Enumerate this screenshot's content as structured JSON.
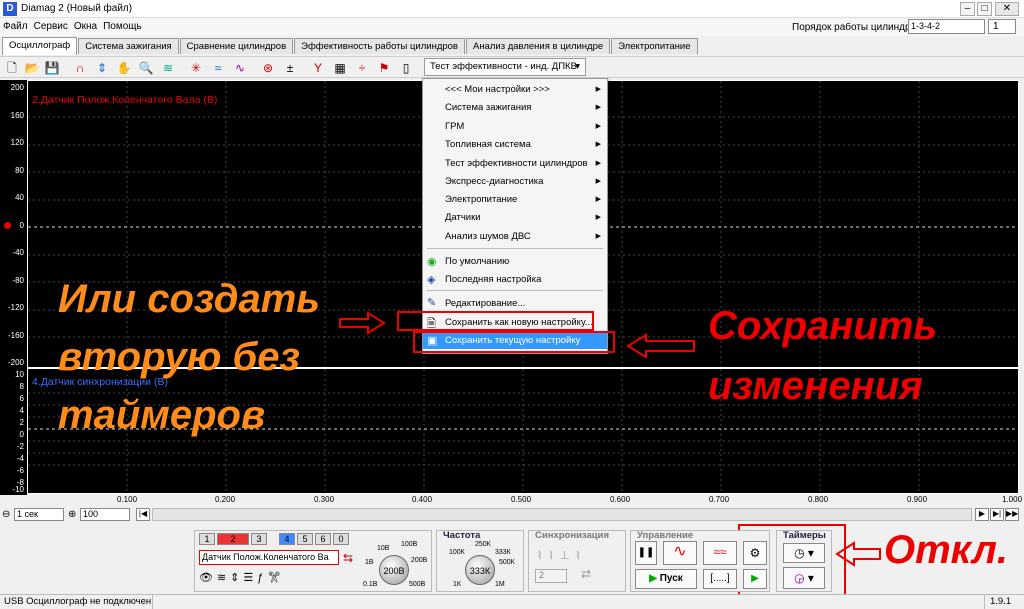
{
  "window": {
    "app_icon": "D",
    "title": "Diamag 2 (Новый файл)"
  },
  "menubar": {
    "items": [
      "Файл",
      "Сервис",
      "Окна",
      "Помощь"
    ]
  },
  "cyl_order": {
    "label": "Порядок работы цилиндров",
    "value": "1-3-4-2",
    "spin_value": "1"
  },
  "tabs": [
    "Осциллограф",
    "Система зажигания",
    "Сравнение цилиндров",
    "Эффективность работы цилиндров",
    "Анализ давления в цилиндре",
    "Электропитание"
  ],
  "toolbar": {
    "preset_button": "Тест эффективности - инд. ДПКВ"
  },
  "scope": {
    "ch1_label": "2.Датчик Полож.Коленчатого Вала (В)",
    "ch2_label": "4.Датчик синхронизации (В)",
    "y1": [
      "200",
      "160",
      "120",
      "80",
      "40",
      "0",
      "-40",
      "-80",
      "-120",
      "-160",
      "-200"
    ],
    "y2": [
      "10",
      "8",
      "6",
      "4",
      "2",
      "0",
      "-2",
      "-4",
      "-6",
      "-8",
      "-10"
    ],
    "x": [
      "0.100",
      "0.200",
      "0.300",
      "0.400",
      "0.500",
      "0.600",
      "0.700",
      "0.800",
      "0.900",
      "1.000"
    ]
  },
  "menu": {
    "items": [
      {
        "label": "<<< Мои настройки >>>",
        "sub": true
      },
      {
        "label": "Система зажигания",
        "sub": true
      },
      {
        "label": "ГРМ",
        "sub": true
      },
      {
        "label": "Топливная система",
        "sub": true
      },
      {
        "label": "Тест эффективности цилиндров",
        "sub": true
      },
      {
        "label": "Экспресс-диагностика",
        "sub": true
      },
      {
        "label": "Электропитание",
        "sub": true
      },
      {
        "label": "Датчики",
        "sub": true
      },
      {
        "label": "Анализ шумов ДВС",
        "sub": true
      }
    ],
    "default": "По умолчанию",
    "last": "Последняя настройка",
    "edit": "Редактирование...",
    "save_new": "Сохранить как новую настройку...",
    "save_current": "Сохранить текущую настройку"
  },
  "annotations": {
    "left": [
      "Или создать",
      "вторую без",
      "таймеров"
    ],
    "right": [
      "Сохранить",
      "изменения"
    ],
    "off": "Откл."
  },
  "bottom": {
    "time_value": "1 сек",
    "count_value": "100",
    "channel_buttons": [
      "1",
      "2",
      "3",
      "4",
      "5",
      "6",
      "0"
    ],
    "sensor_field": "Датчик Полож.Коленчатого Ва",
    "volt_labels": [
      "10В",
      "100В",
      "1В",
      "200В",
      "0.1В",
      "500В"
    ],
    "volt_knob": "200В",
    "freq_title": "Частота",
    "freq_labels": [
      "250К",
      "100К",
      "333К",
      "500К",
      "1К",
      "1М"
    ],
    "freq_knob": "333К",
    "sync_title": "Синхронизация",
    "sync_value": "2",
    "control_title": "Управление",
    "start_label": "Пуск",
    "dots_label": "[.....]",
    "timers_title": "Таймеры"
  },
  "status": {
    "left": "USB Осциллограф не подключен",
    "version": "1.9.1"
  }
}
